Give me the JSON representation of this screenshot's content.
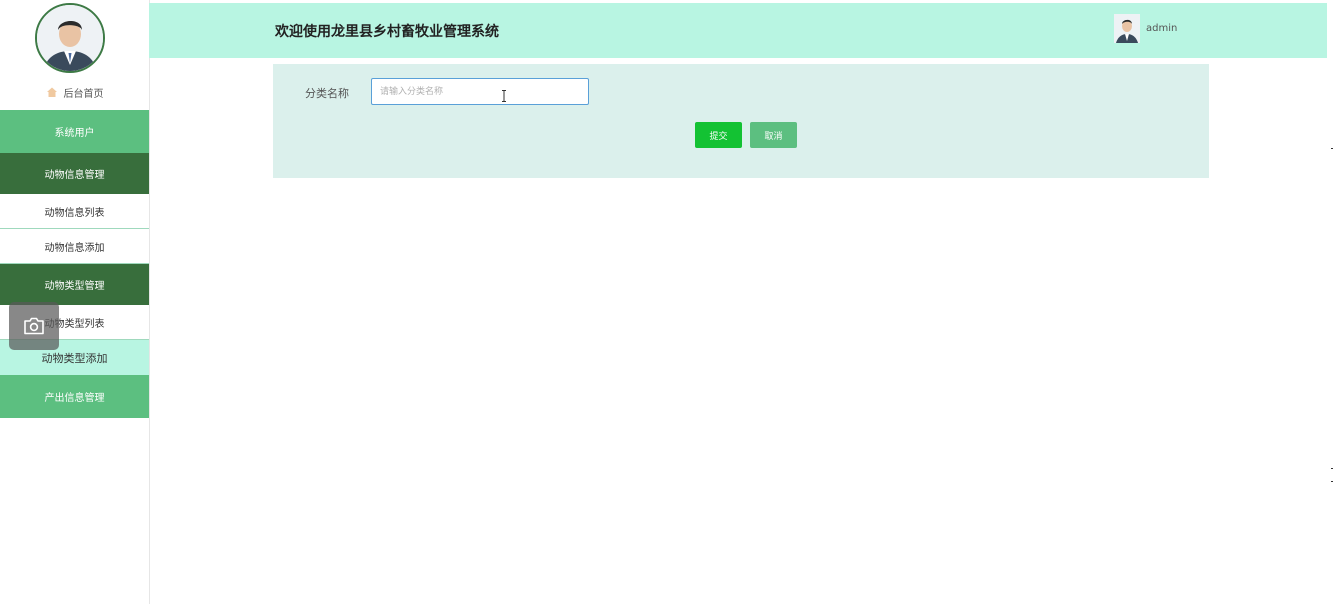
{
  "sidebar": {
    "home_label": "后台首页",
    "menu": [
      {
        "label": "系统用户",
        "kind": "green"
      },
      {
        "label": "动物信息管理",
        "kind": "dark"
      },
      {
        "label": "动物信息列表",
        "kind": "sub"
      },
      {
        "label": "动物信息添加",
        "kind": "sub"
      },
      {
        "label": "动物类型管理",
        "kind": "dark"
      },
      {
        "label": "动物类型列表",
        "kind": "sub"
      },
      {
        "label": "动物类型添加",
        "kind": "sub-active"
      },
      {
        "label": "产出信息管理",
        "kind": "green"
      }
    ]
  },
  "header": {
    "title": "欢迎使用龙里县乡村畜牧业管理系统",
    "username": "admin"
  },
  "form": {
    "category_label": "分类名称",
    "category_placeholder": "请输入分类名称",
    "category_value": "",
    "submit_label": "提交",
    "cancel_label": "取消"
  },
  "colors": {
    "header_bg": "#b8f5e2",
    "menu_green": "#5cbf80",
    "menu_dark": "#386e3c",
    "submit_green": "#13c233",
    "panel_bg": "#dbf0ec"
  }
}
